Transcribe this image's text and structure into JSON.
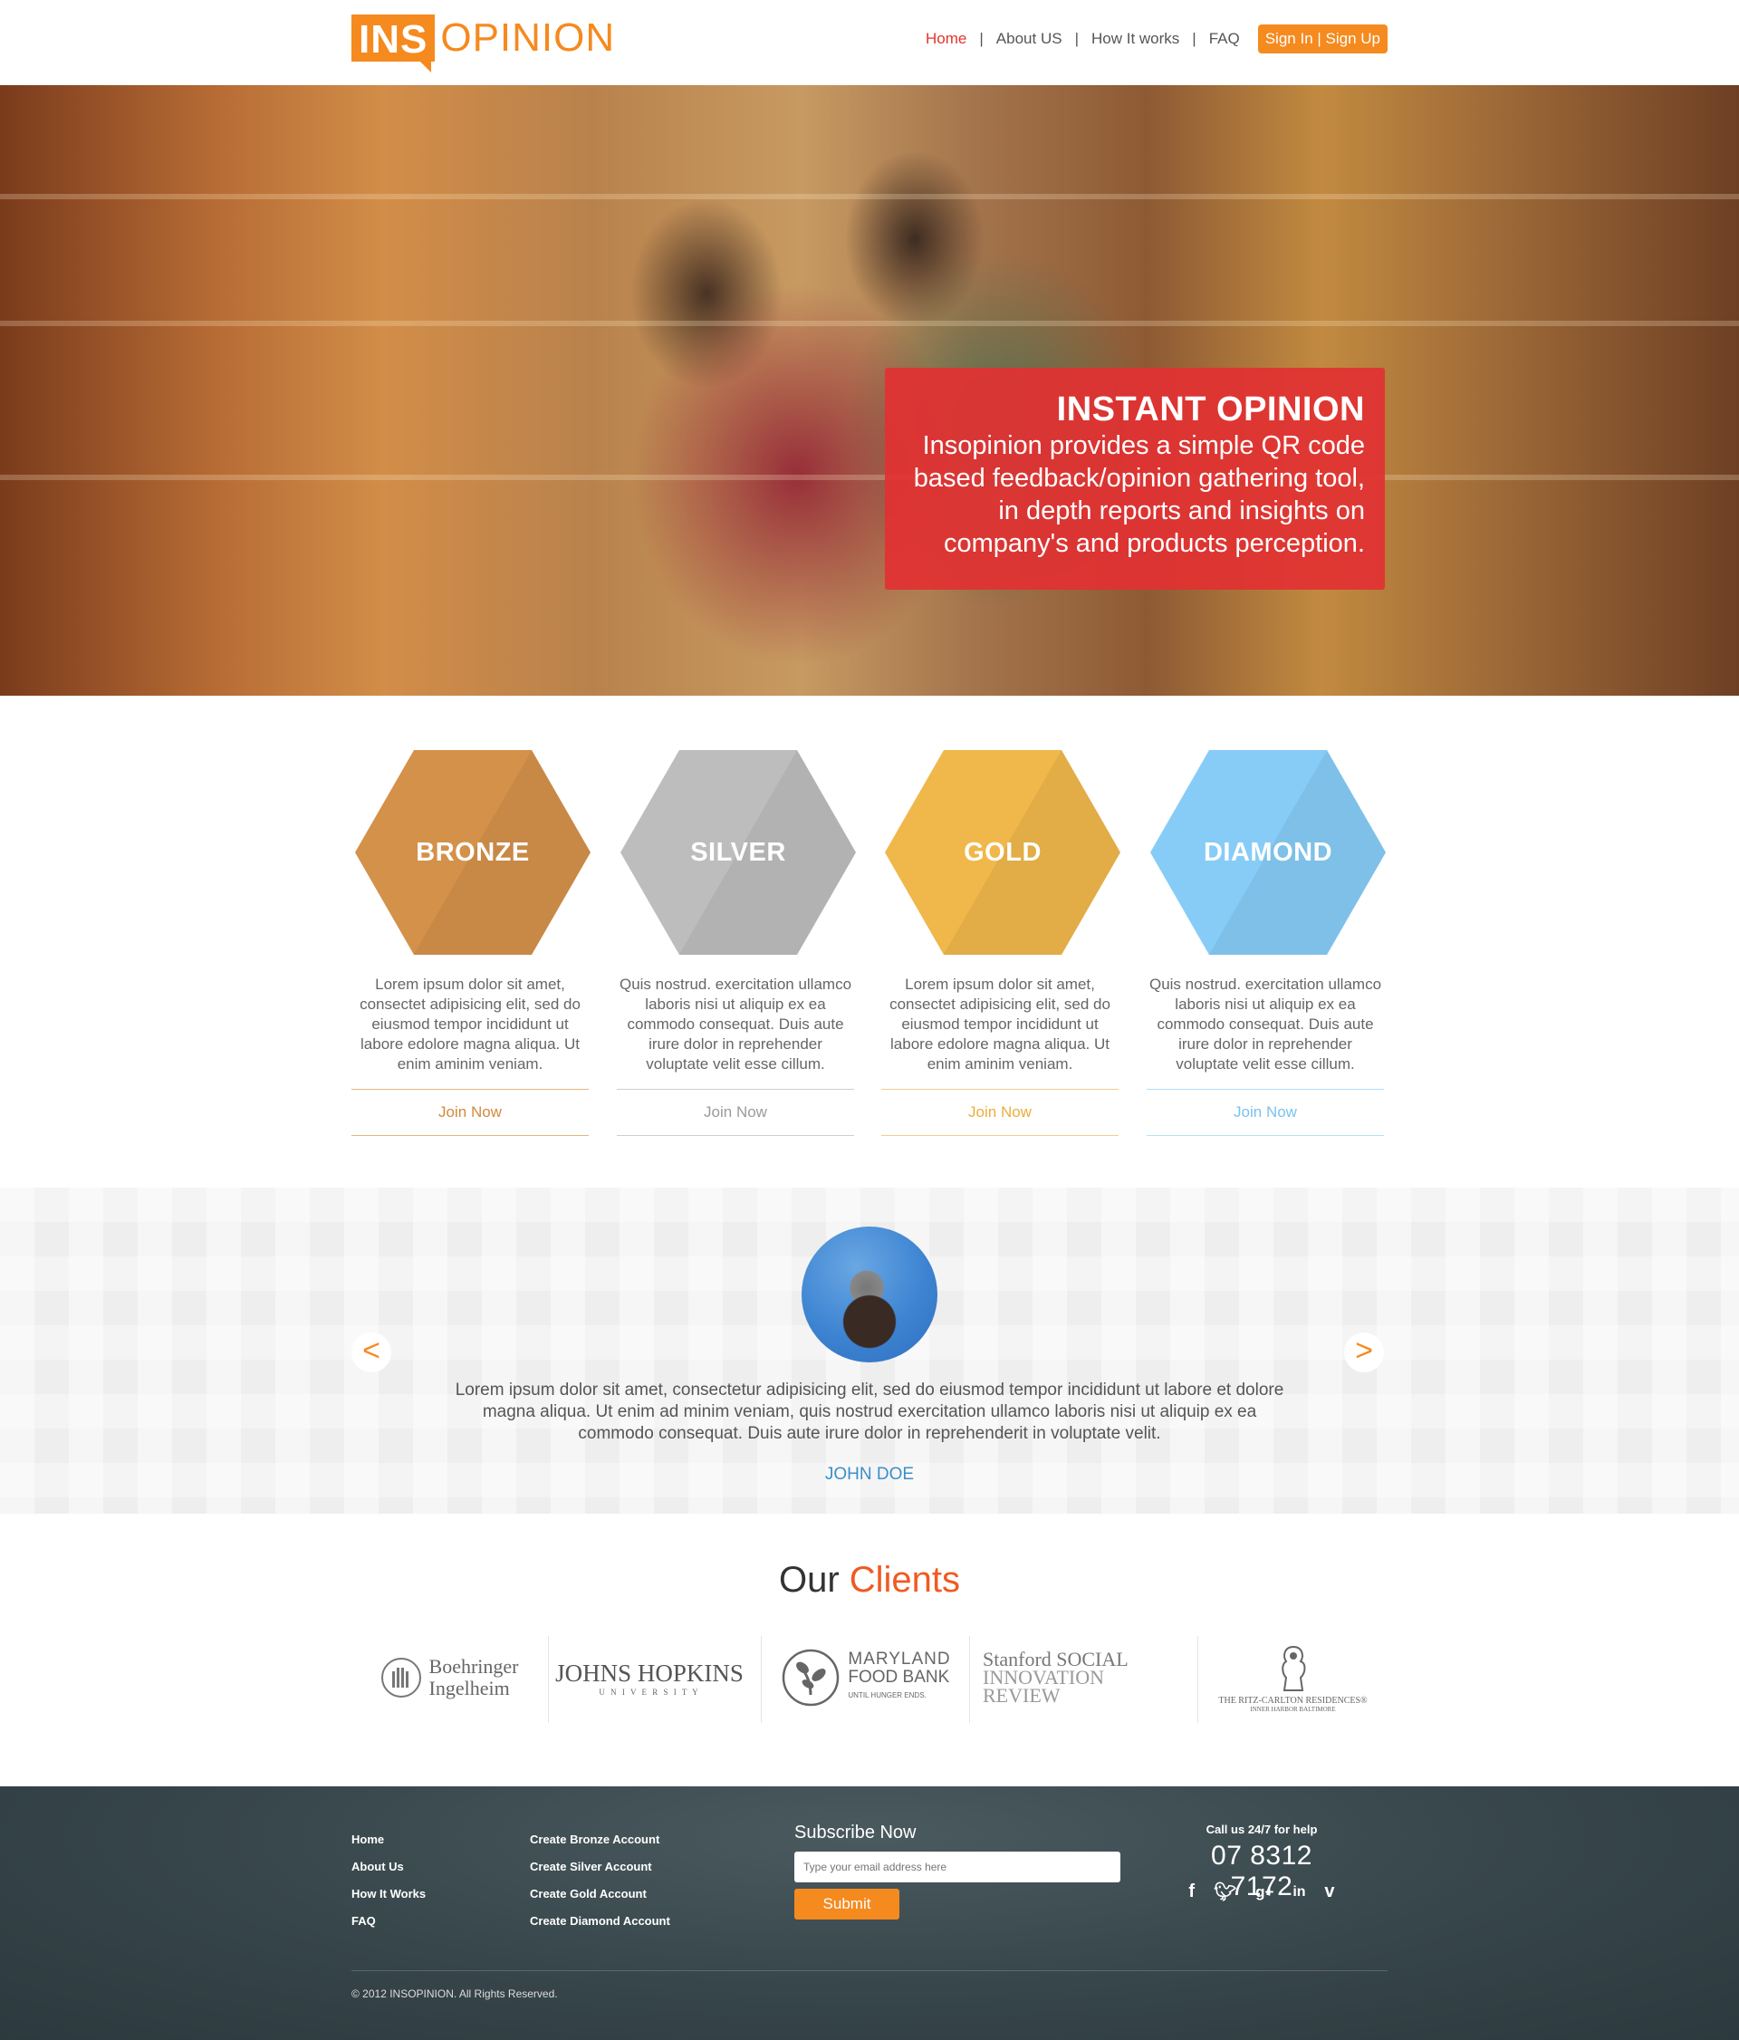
{
  "header": {
    "logo_ins": "INS",
    "logo_rest": "OPINION",
    "nav": [
      {
        "label": "Home"
      },
      {
        "label": "About US"
      },
      {
        "label": "How It works"
      },
      {
        "label": "FAQ"
      }
    ],
    "separator": "|",
    "signin_label": "Sign In | Sign Up"
  },
  "hero": {
    "title": "INSTANT OPINION",
    "text": "Insopinion provides a simple QR code based feedback/opinion gathering tool, in depth reports and insights on company's and products perception."
  },
  "plans": [
    {
      "name": "BRONZE",
      "color": "#d4914a",
      "desc": "Lorem ipsum dolor sit amet, consectet adipisicing elit, sed do eiusmod tempor incididunt ut labore edolore magna aliqua. Ut enim aminim veniam.",
      "cta": "Join Now",
      "cta_color": "#d4893d"
    },
    {
      "name": "SILVER",
      "color": "#bdbdbd",
      "desc": "Quis nostrud. exercitation ullamco laboris nisi ut aliquip ex ea commodo consequat. Duis aute irure dolor in reprehender voluptate velit esse cillum.",
      "cta": "Join Now",
      "cta_color": "#9b9b9b"
    },
    {
      "name": "GOLD",
      "color": "#f0b74a",
      "desc": "Lorem ipsum dolor sit amet, consectet adipisicing elit, sed do eiusmod tempor incididunt ut labore edolore magna aliqua. Ut enim aminim veniam.",
      "cta": "Join Now",
      "cta_color": "#ecad3c"
    },
    {
      "name": "DIAMOND",
      "color": "#86ccf7",
      "desc": "Quis nostrud. exercitation ullamco laboris nisi ut aliquip ex ea commodo consequat. Duis aute irure dolor in reprehender voluptate velit esse cillum.",
      "cta": "Join Now",
      "cta_color": "#78c3f0"
    }
  ],
  "testimonial": {
    "prev": "<",
    "next": ">",
    "quote": "Lorem ipsum dolor sit amet, consectetur adipisicing elit, sed do eiusmod tempor incididunt ut labore et dolore magna aliqua. Ut enim ad minim veniam, quis nostrud exercitation ullamco laboris nisi ut aliquip ex ea commodo consequat. Duis aute irure dolor in reprehenderit in voluptate velit.",
    "author": "JOHN DOE"
  },
  "clients": {
    "title_plain": "Our ",
    "title_highlight": "Clients",
    "logos": [
      {
        "line1": "Boehringer",
        "line2": "Ingelheim"
      },
      {
        "line1": "JOHNS HOPKINS",
        "line2": "U N I V E R S I T Y"
      },
      {
        "line1": "MARYLAND",
        "line2": "FOOD BANK",
        "line3": "UNTIL HUNGER ENDS."
      },
      {
        "line1": "Stanford SOCIAL",
        "line2": "INNOVATION REVIEW"
      },
      {
        "line1": "THE RITZ-CARLTON RESIDENCES®",
        "line2": "INNER HARBOR BALTIMORE"
      }
    ]
  },
  "footer": {
    "col1": [
      "Home",
      "About Us",
      "How It Works",
      "FAQ"
    ],
    "col2": [
      "Create Bronze Account",
      "Create Silver Account",
      "Create Gold Account",
      "Create Diamond Account"
    ],
    "subscribe_title": "Subscribe Now",
    "subscribe_placeholder": "Type your email address here",
    "submit_label": "Submit",
    "call_label": "Call us 24/7 for help",
    "phone": "07 8312 7172",
    "social": [
      "facebook",
      "twitter",
      "google-plus",
      "linkedin",
      "vimeo"
    ],
    "copyright": "© 2012 INSOPINION. All Rights Reserved."
  },
  "colors": {
    "brand": "#f58a1f",
    "active_nav": "#e0352b",
    "hero_card": "#e23132",
    "author": "#3a8fc9",
    "clients_highlight": "#f05a22",
    "footer_bg": "#38474c"
  }
}
